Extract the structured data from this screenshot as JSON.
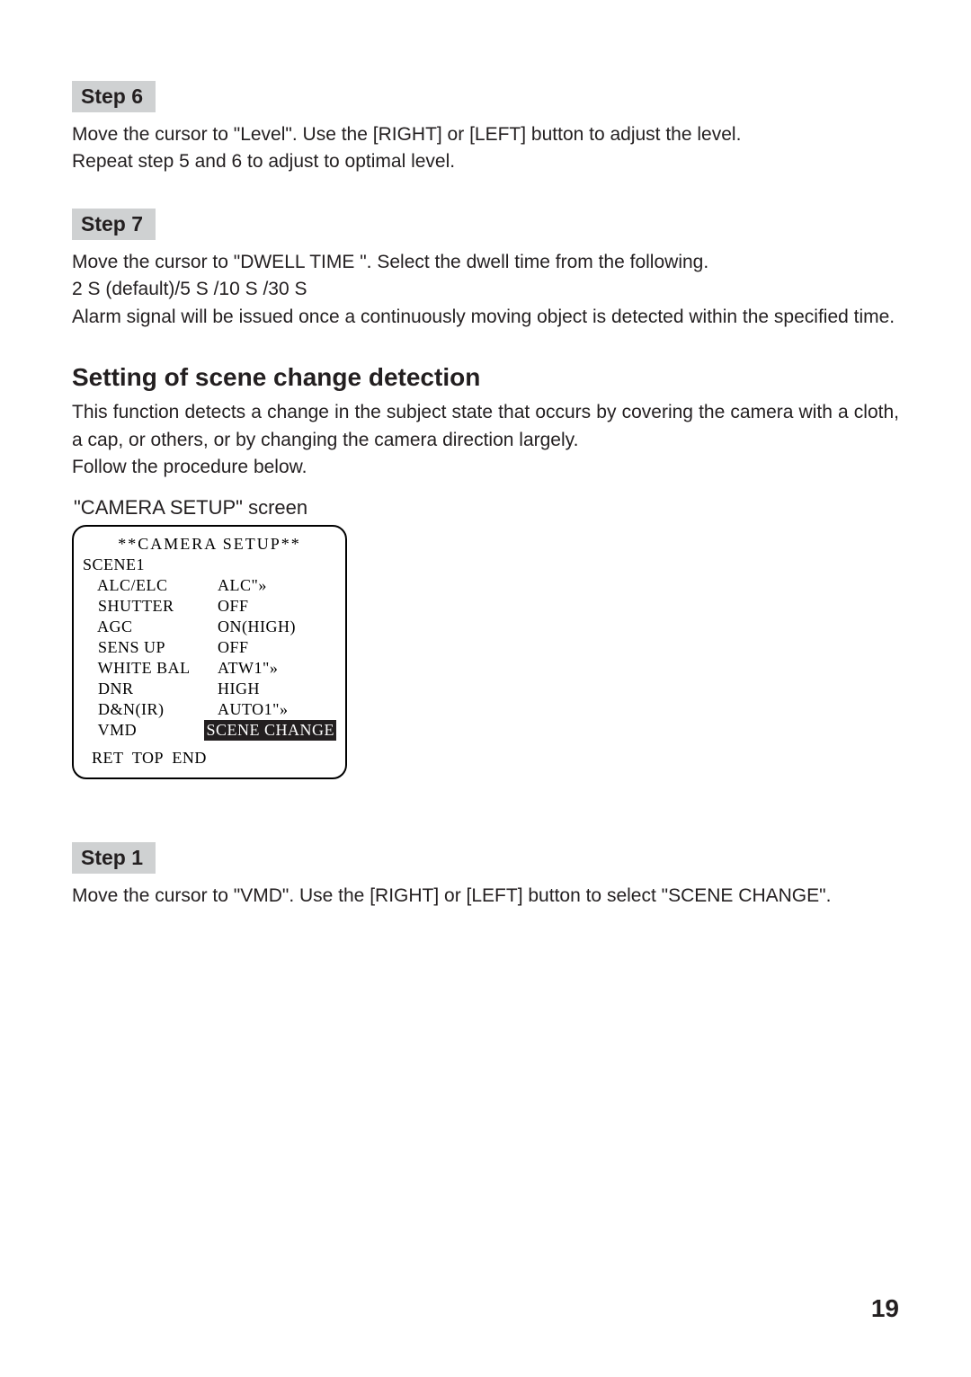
{
  "step6": {
    "label": "Step 6",
    "text": "Move the cursor to \"Level\". Use the [RIGHT] or [LEFT] button to adjust the level.\nRepeat step 5 and 6 to adjust to optimal level."
  },
  "step7": {
    "label": "Step 7",
    "line1": "Move the cursor to \"DWELL TIME \". Select the dwell time from the following.",
    "line2": "2 S (default)/5 S /10 S /30 S",
    "line3": "Alarm signal will be issued once a continuously moving object is detected within the specified time."
  },
  "section": {
    "heading": "Setting of scene change detection",
    "intro": "This function detects a change in the subject state that occurs by covering the camera with a cloth, a cap, or others, or by changing the camera direction largely.",
    "follow": "Follow the procedure below.",
    "screen_label": "\"CAMERA SETUP\" screen"
  },
  "osd": {
    "title": "**CAMERA SETUP**",
    "scene": "SCENE1",
    "rows": [
      {
        "k": " ALC/ELC",
        "v": "ALC\"»"
      },
      {
        "k": " SHUTTER",
        "v": "OFF"
      },
      {
        "k": " AGC",
        "v": "ON(HIGH)"
      },
      {
        "k": " SENS UP",
        "v": "OFF"
      },
      {
        "k": " WHITE BAL",
        "v": "ATW1\"»"
      },
      {
        "k": " DNR",
        "v": "HIGH"
      },
      {
        "k": " D&N(IR)",
        "v": "AUTO1\"»"
      },
      {
        "k": " VMD",
        "v": "SCENE CHANGE",
        "hl": true
      }
    ],
    "footer": "RET  TOP  END"
  },
  "step1": {
    "label": "Step 1",
    "text": "Move the cursor to \"VMD\". Use the [RIGHT] or [LEFT] button to select \"SCENE CHANGE\"."
  },
  "page_number": "19"
}
